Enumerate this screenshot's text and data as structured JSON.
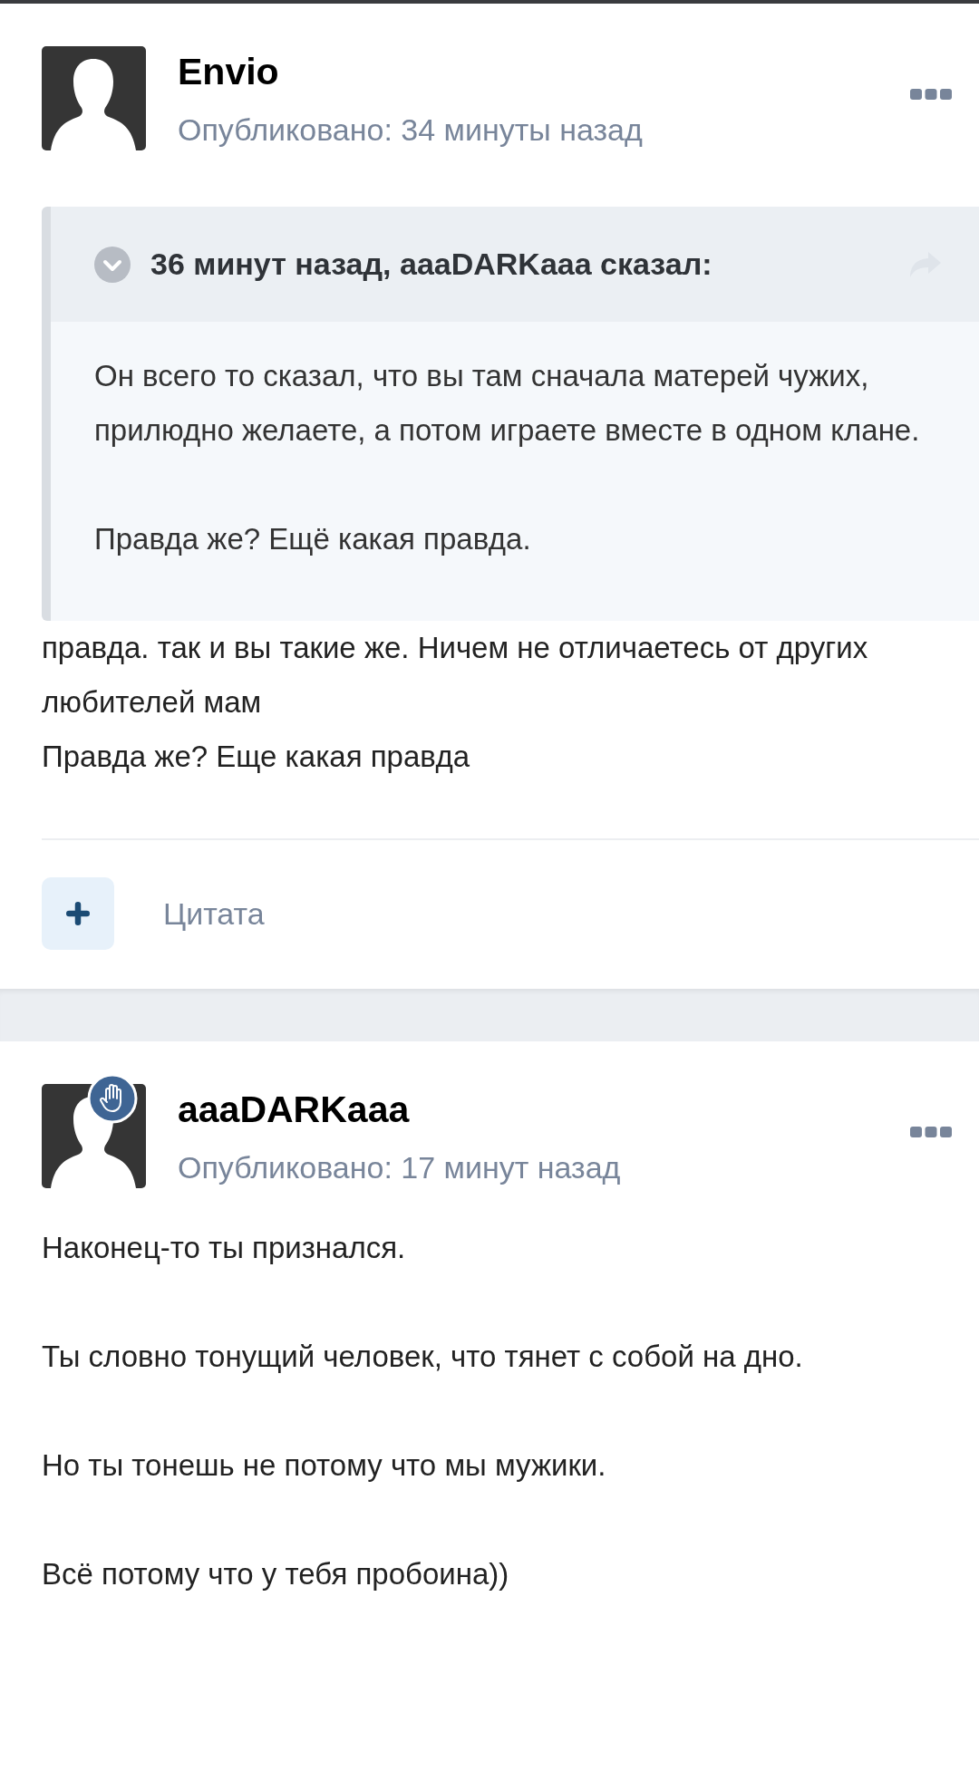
{
  "posts": [
    {
      "author": "Envio",
      "badge": false,
      "meta": "Опубликовано: 34 минуты назад",
      "quote": {
        "header": "36 минут назад, aaaDARKaaa сказал:",
        "paragraphs": [
          [
            "Он всего то сказал, что вы там сначала  матерей чужих, прилюдно желаете, а потом играете вместе в одном клане."
          ],
          [
            "Правда же? Ещё какая правда."
          ]
        ]
      },
      "paragraphs": [
        [
          "правда. так и вы такие же. Ничем не отличаетесь от других любителей мам",
          "Правда же? Еще какая правда"
        ]
      ],
      "footer": {
        "quote_label": "Цитата"
      }
    },
    {
      "author": "aaaDARKaaa",
      "badge": true,
      "meta": "Опубликовано: 17 минут назад",
      "paragraphs": [
        [
          "Наконец-то ты признался."
        ],
        [
          "Ты словно тонущий человек, что тянет с собой на дно."
        ],
        [
          "Но ты тонешь не потому что мы мужики."
        ],
        [
          "Всё потому что у тебя пробоина))"
        ]
      ]
    }
  ]
}
